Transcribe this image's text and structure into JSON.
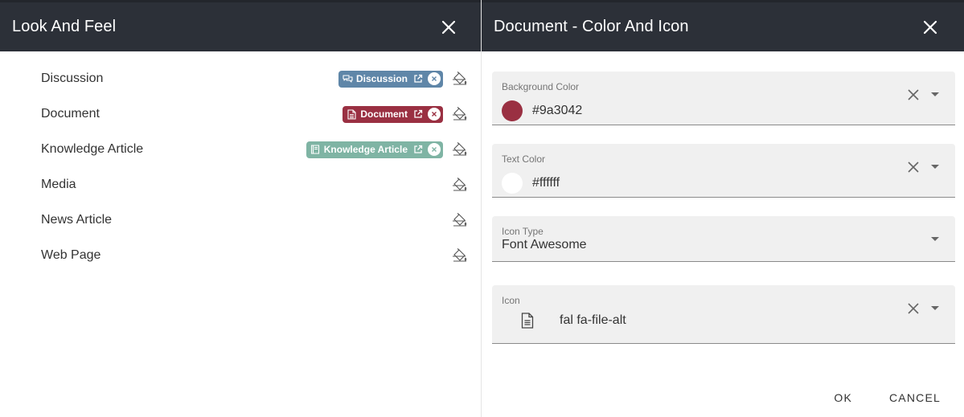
{
  "left": {
    "title": "Look And Feel",
    "types": [
      {
        "label": "Discussion",
        "chip": {
          "text": "Discussion",
          "color": "#5f86a8",
          "icon": "comments-icon"
        }
      },
      {
        "label": "Document",
        "chip": {
          "text": "Document",
          "color": "#9a3042",
          "icon": "file-alt-icon"
        }
      },
      {
        "label": "Knowledge Article",
        "chip": {
          "text": "Knowledge Article",
          "color": "#7fb4a4",
          "icon": "book-icon"
        }
      },
      {
        "label": "Media"
      },
      {
        "label": "News Article"
      },
      {
        "label": "Web Page"
      }
    ]
  },
  "right": {
    "title": "Document - Color And Icon",
    "background_color": {
      "label": "Background Color",
      "value": "#9a3042"
    },
    "text_color": {
      "label": "Text Color",
      "value": "#ffffff"
    },
    "icon_type": {
      "label": "Icon Type",
      "value": "Font Awesome"
    },
    "icon": {
      "label": "Icon",
      "value": "fal fa-file-alt",
      "icon_name": "file-alt-icon"
    },
    "ok_label": "OK",
    "cancel_label": "CANCEL"
  },
  "colors": {
    "header_bg": "#2c3038",
    "field_bg": "#f0f0f0"
  }
}
